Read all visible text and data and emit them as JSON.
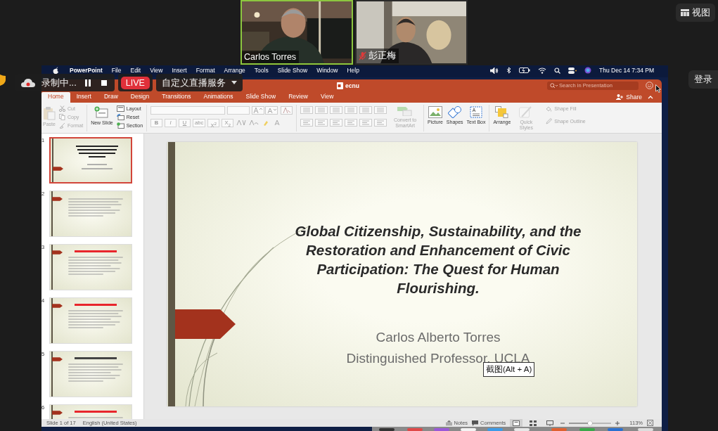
{
  "meeting": {
    "participants": [
      {
        "name": "Carlos Torres",
        "active_speaker": true,
        "muted": false,
        "kind": "picture"
      },
      {
        "name": "彭正梅",
        "active_speaker": false,
        "muted": true,
        "kind": "picture"
      }
    ],
    "view_button": "视图",
    "login_button": "登录"
  },
  "recording_bar": {
    "status": "录制中...",
    "live_badge": "LIVE",
    "service": "自定义直播服务"
  },
  "screenshot_tooltip": "截图(Alt + A)",
  "menu_bar": {
    "app": "PowerPoint",
    "items": [
      "File",
      "Edit",
      "View",
      "Insert",
      "Format",
      "Arrange",
      "Tools",
      "Slide Show",
      "Window",
      "Help"
    ],
    "clock": "Thu Dec 14 7:34 PM"
  },
  "powerpoint": {
    "title": "ecnu",
    "search": {
      "placeholder": "Search in Presentation"
    },
    "share": "Share",
    "tabs": [
      {
        "label": "Home",
        "selected": true
      },
      {
        "label": "Insert",
        "selected": false
      },
      {
        "label": "Draw",
        "selected": false
      },
      {
        "label": "Design",
        "selected": false
      },
      {
        "label": "Transitions",
        "selected": false
      },
      {
        "label": "Animations",
        "selected": false
      },
      {
        "label": "Slide Show",
        "selected": false
      },
      {
        "label": "Review",
        "selected": false
      },
      {
        "label": "View",
        "selected": false
      }
    ],
    "ribbon": {
      "paste": {
        "label": "Paste",
        "disabled": true
      },
      "clipboard": [
        {
          "label": "Cut",
          "disabled": true
        },
        {
          "label": "Copy",
          "disabled": true
        },
        {
          "label": "Format",
          "disabled": true
        }
      ],
      "new_slide": {
        "label": "New Slide",
        "disabled": false
      },
      "slide_commands": [
        {
          "label": "Layout",
          "disabled": false
        },
        {
          "label": "Reset",
          "disabled": false
        },
        {
          "label": "Section",
          "disabled": false
        }
      ],
      "font_buttons": [
        {
          "label": "B",
          "disabled": true
        },
        {
          "label": "I",
          "disabled": true
        },
        {
          "label": "U",
          "disabled": true
        },
        {
          "label": "abc",
          "disabled": true
        },
        {
          "label": "X$^{2}$",
          "disabled": true
        },
        {
          "label": "X$_{2}$",
          "disabled": true
        }
      ],
      "convert": {
        "label": "Convert to SmartArt",
        "disabled": true
      },
      "insert": [
        {
          "label": "Picture",
          "disabled": false
        },
        {
          "label": "Shapes",
          "disabled": false
        },
        {
          "label": "Text Box",
          "disabled": false
        }
      ],
      "arrange": {
        "label": "Arrange",
        "disabled": false
      },
      "quick_styles": {
        "label": "Quick Styles",
        "disabled": true
      },
      "shape_format": [
        {
          "label": "Shape Fill",
          "disabled": true
        },
        {
          "label": "Shape Outline",
          "disabled": true
        }
      ]
    },
    "thumbnails": [
      {
        "number": "1",
        "selected": true,
        "kind": "title"
      },
      {
        "number": "2",
        "selected": false,
        "kind": "bullets"
      },
      {
        "number": "3",
        "selected": false,
        "kind": "bullets",
        "color": "#e8262c"
      },
      {
        "number": "4",
        "selected": false,
        "kind": "bullets",
        "color": "#e8262c"
      },
      {
        "number": "5",
        "selected": false,
        "kind": "bullets",
        "color": "#444444"
      },
      {
        "number": "6",
        "selected": false,
        "kind": "bullets",
        "color": "#e8262c"
      }
    ],
    "slide": {
      "title": "Global Citizenship, Sustainability, and the Restoration and Enhancement of Civic Participation: The Quest for Human Flourishing.",
      "subtitle_lines": [
        "Carlos Alberto Torres",
        "Distinguished Professor, UCLA"
      ]
    },
    "status_bar": {
      "slide_position": "Slide 1 of 17",
      "language": "English (United States)",
      "notes": "Notes",
      "comments": "Comments",
      "views": [
        {
          "kind": "normal",
          "selected": true
        },
        {
          "kind": "sorter",
          "selected": false
        },
        {
          "kind": "reading",
          "selected": false
        }
      ],
      "zoom": {
        "level": 0.5,
        "reading": "113%"
      }
    }
  }
}
